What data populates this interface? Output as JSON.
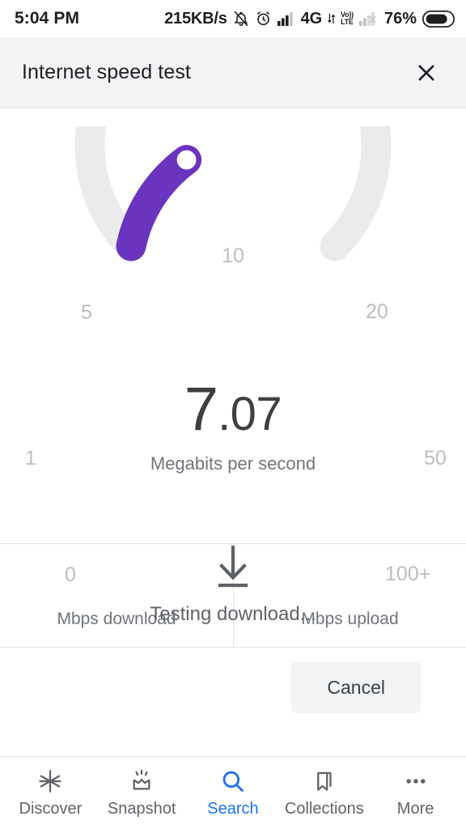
{
  "statusbar": {
    "time": "5:04 PM",
    "network_speed": "215KB/s",
    "battery_percent": "76%",
    "volte_top": "Vo))",
    "volte_bottom": "LTE",
    "network_type": "4G",
    "icons": [
      "notifications-off-icon",
      "alarm-icon",
      "signal-bars-icon",
      "network-4g-icon",
      "volte-icon",
      "signal-bars-secondary-icon",
      "battery-icon"
    ]
  },
  "dialog": {
    "title": "Internet speed test",
    "close_label": "close-icon"
  },
  "gauge": {
    "value_integer": "7",
    "value_decimal": ".07",
    "units": "Megabits per second",
    "phase_label": "Testing download...",
    "phase_icon": "download-arrow-icon",
    "ticks": [
      {
        "label": "10",
        "name": "gauge-tick-10"
      },
      {
        "label": "5",
        "name": "gauge-tick-5"
      },
      {
        "label": "20",
        "name": "gauge-tick-20"
      },
      {
        "label": "1",
        "name": "gauge-tick-1"
      },
      {
        "label": "50",
        "name": "gauge-tick-50"
      },
      {
        "label": "0",
        "name": "gauge-tick-0"
      },
      {
        "label": "100+",
        "name": "gauge-tick-100plus"
      }
    ],
    "colors": {
      "track": "#ebebeb",
      "progress": "#6b34bf",
      "knob_fill": "#ffffff",
      "value_text": "#3c4043",
      "tick_text": "#bdbdbd"
    }
  },
  "chart_data": {
    "type": "gauge",
    "title": "Internet speed test",
    "value": 7.07,
    "unit": "Megabits per second",
    "scale_ticks": [
      0,
      1,
      5,
      10,
      20,
      50,
      100
    ],
    "scale_tick_labels": [
      "0",
      "1",
      "5",
      "10",
      "20",
      "50",
      "100+"
    ],
    "scale": "logarithmic",
    "range": [
      0,
      100
    ],
    "arc_start_deg": 200,
    "arc_end_deg": 520,
    "progress_fraction": 0.44,
    "track_color": "#ebebeb",
    "progress_color": "#6b34bf",
    "status": "Testing download..."
  },
  "results": [
    {
      "value": "",
      "label": "Mbps download",
      "name": "result-download"
    },
    {
      "value": "",
      "label": "Mbps upload",
      "name": "result-upload"
    }
  ],
  "actions": {
    "cancel_label": "Cancel"
  },
  "bottom_nav": {
    "items": [
      {
        "label": "Discover",
        "icon": "asterisk-icon",
        "active": false
      },
      {
        "label": "Snapshot",
        "icon": "snapshot-icon",
        "active": false
      },
      {
        "label": "Search",
        "icon": "search-icon",
        "active": true
      },
      {
        "label": "Collections",
        "icon": "bookmark-icon",
        "active": false
      },
      {
        "label": "More",
        "icon": "more-dots-icon",
        "active": false
      }
    ],
    "active_color": "#1a73e8",
    "inactive_color": "#5f6368"
  }
}
